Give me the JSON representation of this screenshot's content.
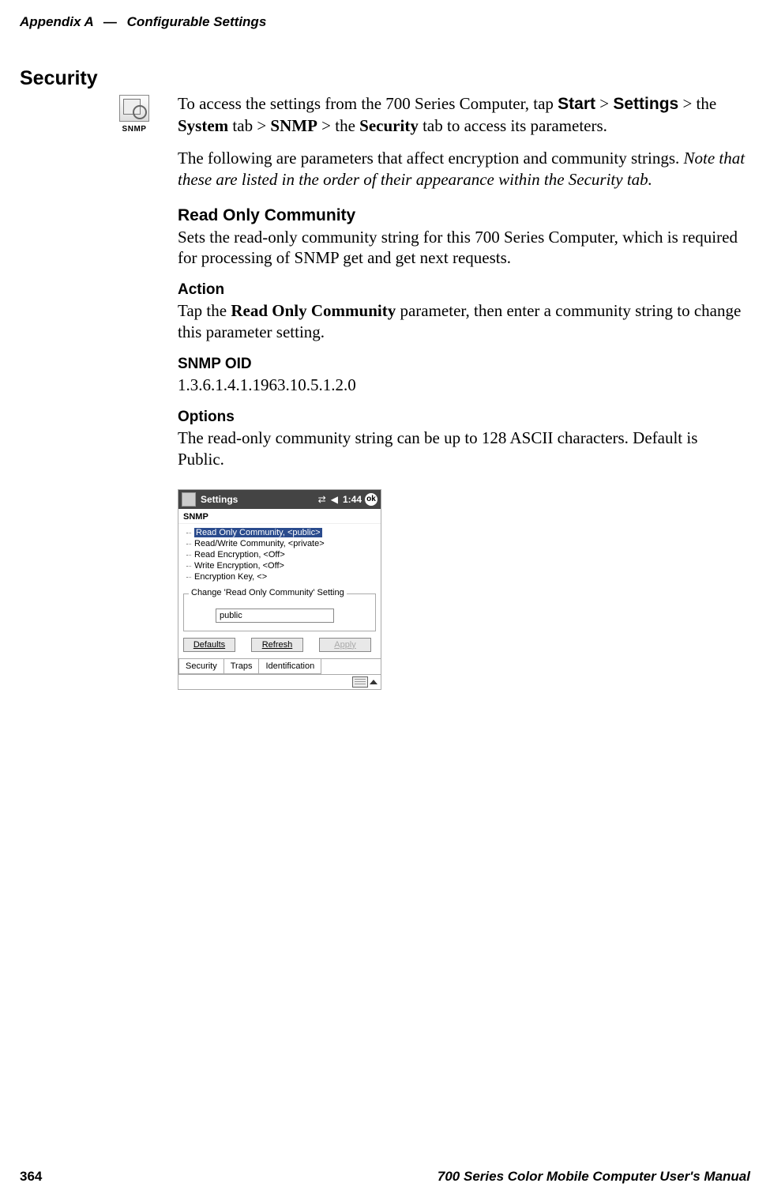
{
  "header": {
    "appendix": "Appendix  A",
    "dash": "—",
    "title": "Configurable Settings"
  },
  "footer": {
    "page": "364",
    "manual": "700 Series Color Mobile Computer User's Manual"
  },
  "section": {
    "title": "Security",
    "snmp_icon_label": "SNMP"
  },
  "intro": {
    "p1_a": "To access the settings from the 700 Series Computer, tap ",
    "p1_start": "Start",
    "p1_gt1": " > ",
    "p1_settings": "Settings",
    "p1_gt2": " > the ",
    "p1_system": "System",
    "p1_tab": " tab > ",
    "p1_snmp": "SNMP",
    "p1_gt3": " > the ",
    "p1_security": "Security",
    "p1_b": " tab to access its parameters.",
    "p2_a": "The following are parameters that affect encryption and community strings. ",
    "p2_note": "Note that these are listed in the order of their appearance within the Security tab."
  },
  "roc": {
    "heading": "Read Only Community",
    "para": "Sets the read-only community string for this 700 Series Computer, which is required for processing of SNMP get and get next requests."
  },
  "action": {
    "heading": "Action",
    "a": "Tap the ",
    "param": "Read Only Community",
    "b": " parameter, then enter a community string to change this parameter setting."
  },
  "oid": {
    "heading": "SNMP OID",
    "value": "1.3.6.1.4.1.1963.10.5.1.2.0"
  },
  "options": {
    "heading": "Options",
    "para": "The read-only community string can be up to 128 ASCII characters. Default is Public."
  },
  "shot": {
    "titlebar": {
      "title": "Settings",
      "time": "1:44",
      "ok": "ok"
    },
    "subtitle": "SNMP",
    "tree": [
      "Read Only Community, <public>",
      "Read/Write Community, <private>",
      "Read Encryption, <Off>",
      "Write Encryption, <Off>",
      "Encryption Key, <>"
    ],
    "fieldset_legend": "Change 'Read Only Community' Setting",
    "textbox_value": "public",
    "buttons": {
      "defaults": "Defaults",
      "refresh": "Refresh",
      "apply": "Apply"
    },
    "tabs": {
      "security": "Security",
      "traps": "Traps",
      "identification": "Identification"
    }
  }
}
